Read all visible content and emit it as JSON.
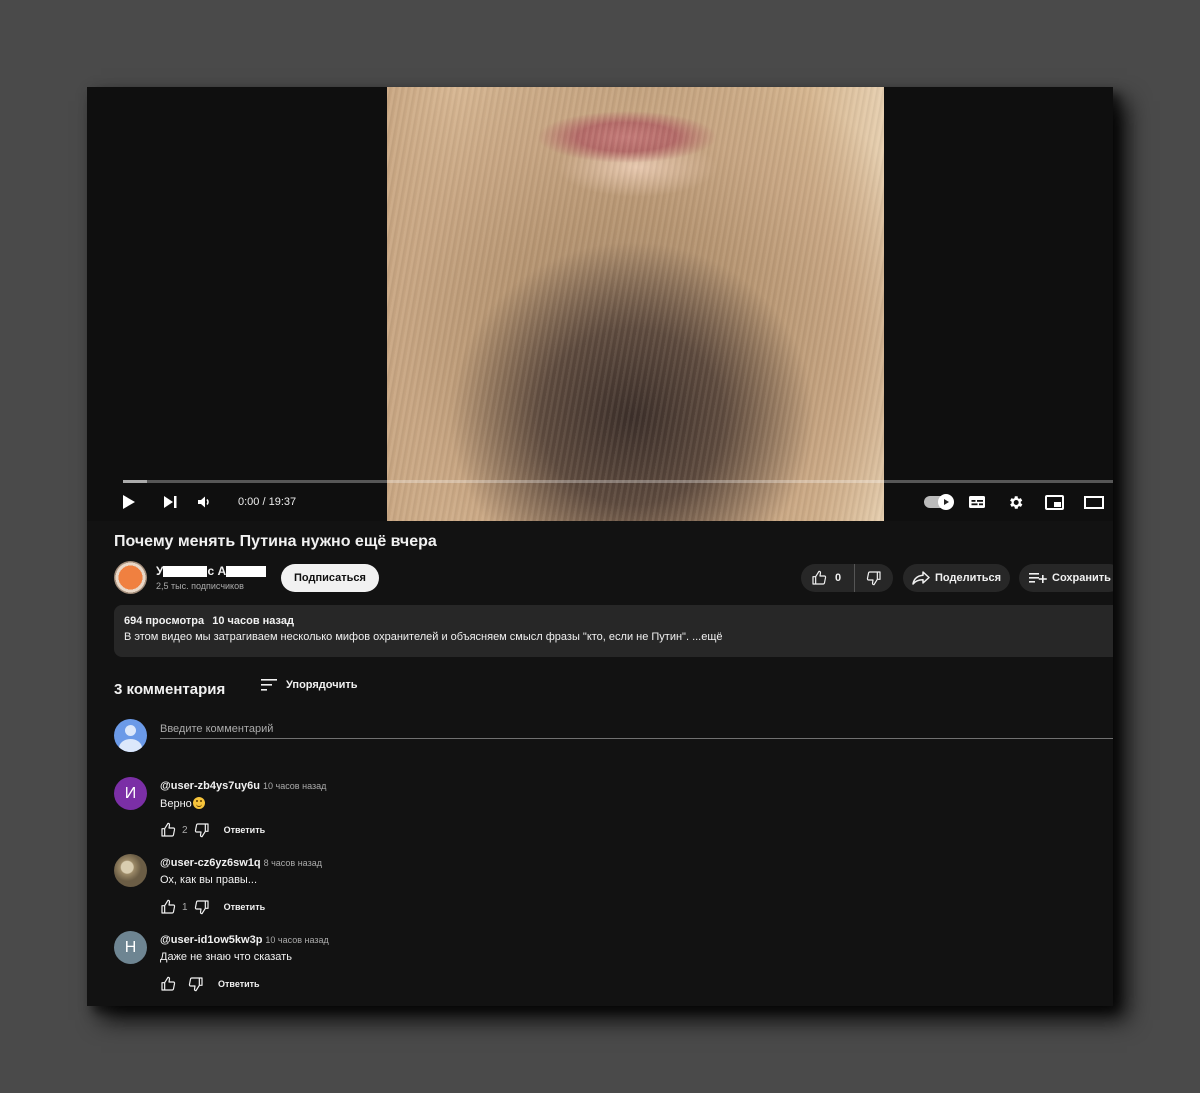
{
  "player": {
    "time_display": "0:00 / 19:37",
    "progress_fraction": 0.0
  },
  "video": {
    "title": "Почему менять Путина нужно ещё вчера"
  },
  "channel": {
    "name_start": "У",
    "name_mid": "с А",
    "subscribers": "2,5 тыс. подписчиков",
    "subscribe_label": "Подписаться"
  },
  "actions": {
    "like_count": "0",
    "share_label": "Поделиться",
    "save_label": "Сохранить"
  },
  "description": {
    "views": "694 просмотра",
    "age": "10 часов назад",
    "text": "В этом видео мы затрагиваем несколько мифов охранителей и объясняем смысл фразы \"кто, если не Путин\". ...ещё"
  },
  "comments_header": {
    "count_label": "3 комментария",
    "sort_label": "Упорядочить"
  },
  "add_comment": {
    "placeholder": "Введите комментарий"
  },
  "comments": [
    {
      "avatar_letter": "И",
      "avatar_color": "#7b2fa6",
      "author": "@user-zb4ys7uy6u",
      "time": "10 часов назад",
      "text": "Верно",
      "has_emoji": true,
      "likes": "2",
      "reply_label": "Ответить"
    },
    {
      "avatar_letter": "",
      "avatar_color": "#8a7a60",
      "author": "@user-cz6yz6sw1q",
      "time": "8 часов назад",
      "text": "Ох, как вы правы...",
      "has_emoji": false,
      "likes": "1",
      "reply_label": "Ответить"
    },
    {
      "avatar_letter": "Н",
      "avatar_color": "#6e8592",
      "author": "@user-id1ow5kw3p",
      "time": "10 часов назад",
      "text": "Даже не знаю что сказать",
      "has_emoji": false,
      "likes": "",
      "reply_label": "Ответить"
    }
  ],
  "colors": {
    "page_background": "#121212",
    "progress_played": "#ff0000",
    "pill_background": "#272727"
  }
}
